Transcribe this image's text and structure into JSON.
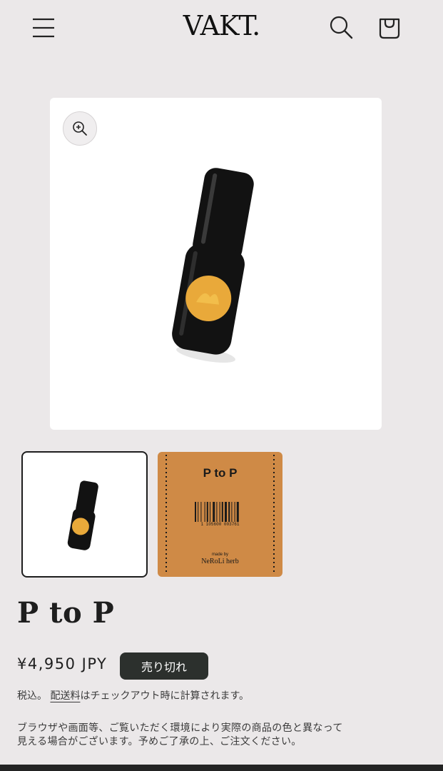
{
  "header": {
    "logo": "VAKT.",
    "menu_icon": "hamburger-icon",
    "search_icon": "search-icon",
    "cart_icon": "cart-icon"
  },
  "gallery": {
    "zoom_icon": "zoom-in-icon",
    "label": {
      "title": "P to P",
      "barcode_number": "1 105600 003761",
      "made_by": "made by",
      "brand": "NeRoLi herb"
    }
  },
  "product": {
    "title": "P to P",
    "price": "¥4,950 JPY",
    "badge": "売り切れ",
    "tax_prefix": "税込。",
    "shipping_link": "配送料",
    "tax_suffix": "はチェックアウト時に計算されます。",
    "notice_line1": "ブラウザや画面等、ご覧いただく環境により実際の商品の色と異なって",
    "notice_line2": "見える場合がございます。予めご了承の上、ご注文ください。"
  },
  "colors": {
    "background": "#ebe8e9",
    "badge_bg": "#2c302d",
    "label_orange": "#cf8a46",
    "bottle": "#121212",
    "sticker": "#e9a93a"
  }
}
